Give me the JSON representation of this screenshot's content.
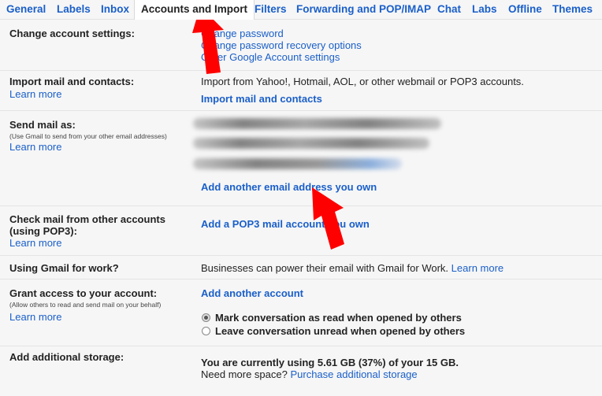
{
  "tabs": [
    {
      "label": "General"
    },
    {
      "label": "Labels"
    },
    {
      "label": "Inbox"
    },
    {
      "label": "Accounts and Import"
    },
    {
      "label": "Filters"
    },
    {
      "label": "Forwarding and POP/IMAP"
    },
    {
      "label": "Chat"
    },
    {
      "label": "Labs"
    },
    {
      "label": "Offline"
    },
    {
      "label": "Themes"
    }
  ],
  "account_settings": {
    "label": "Change account settings:",
    "links": [
      "Change password",
      "Change password recovery options",
      "Other Google Account settings"
    ]
  },
  "import": {
    "label": "Import mail and contacts:",
    "learn": "Learn more",
    "description": "Import from Yahoo!, Hotmail, AOL, or other webmail or POP3 accounts.",
    "action": "Import mail and contacts"
  },
  "send_as": {
    "label": "Send mail as:",
    "sub": "(Use Gmail to send from your other email addresses)",
    "learn": "Learn more",
    "action": "Add another email address you own"
  },
  "check_mail": {
    "label_line1": "Check mail from other accounts",
    "label_line2": "(using POP3):",
    "learn": "Learn more",
    "action": "Add a POP3 mail account you own"
  },
  "work": {
    "label": "Using Gmail for work?",
    "text": "Businesses can power their email with Gmail for Work.",
    "learn": "Learn more"
  },
  "grant": {
    "label": "Grant access to your account:",
    "sub": "(Allow others to read and send mail on your behalf)",
    "learn": "Learn more",
    "action": "Add another account",
    "options": [
      "Mark conversation as read when opened by others",
      "Leave conversation unread when opened by others"
    ],
    "selected_index": 0
  },
  "storage": {
    "label": "Add additional storage:",
    "usage": "You are currently using 5.61 GB (37%) of your 15 GB.",
    "need_more": "Need more space?",
    "purchase": "Purchase additional storage"
  },
  "colors": {
    "link": "#1a5fc9",
    "arrow": "#ff0000",
    "background": "#f6f6f6"
  }
}
